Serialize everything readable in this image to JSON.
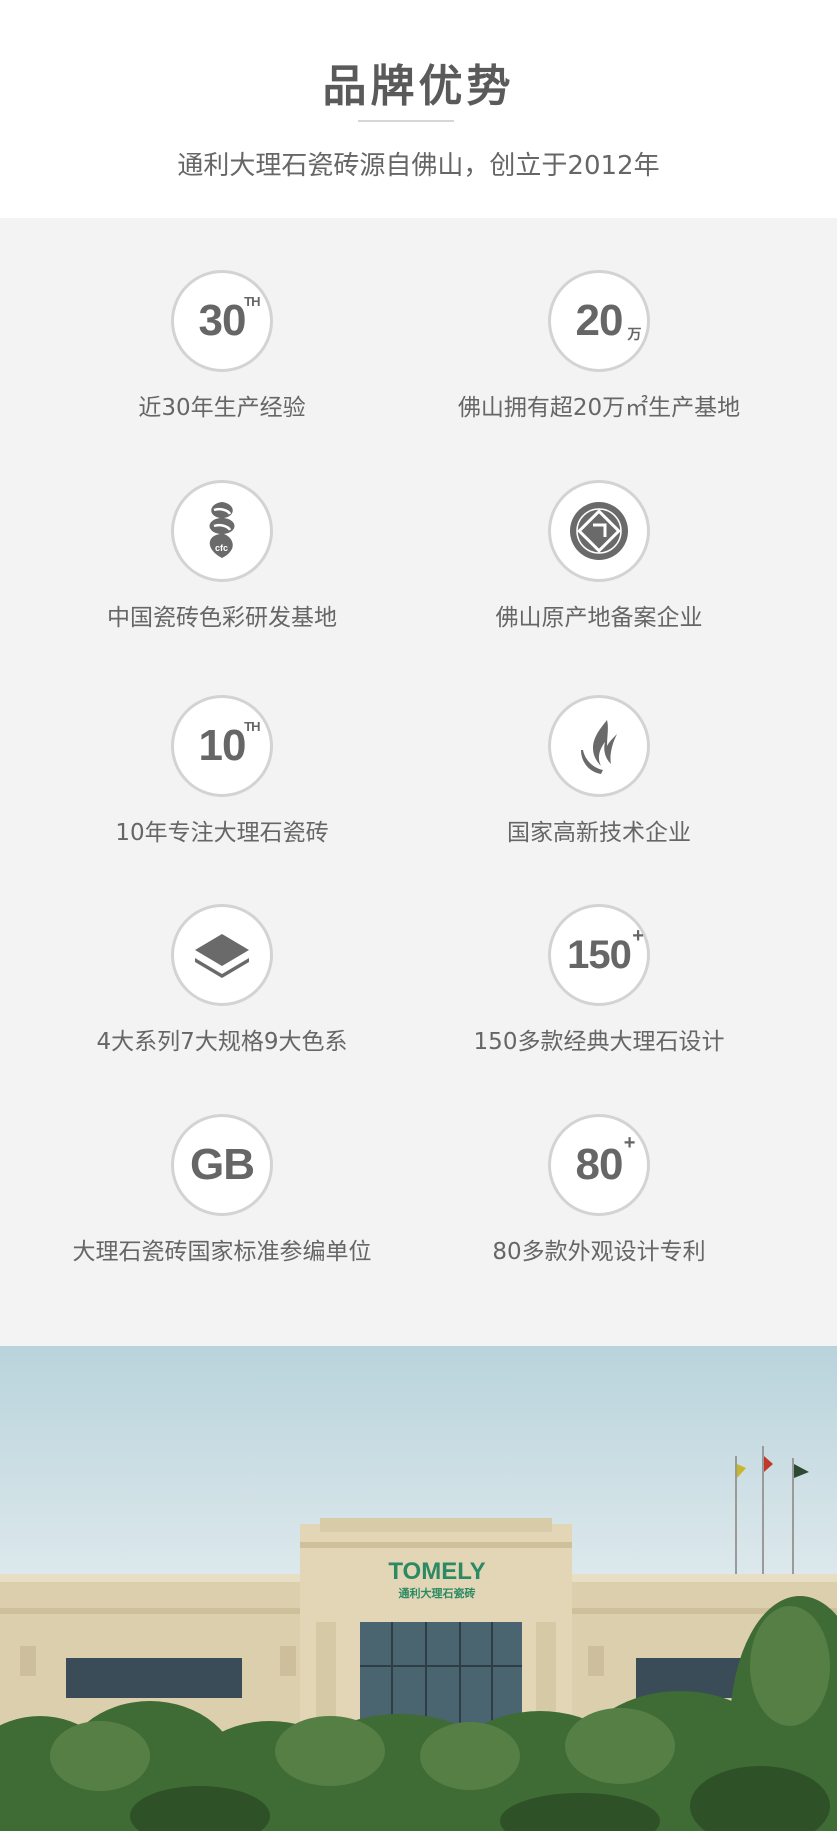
{
  "header": {
    "title": "品牌优势",
    "subtitle": "通利大理石瓷砖源自佛山，创立于2012年"
  },
  "features": [
    {
      "badge": "30",
      "badge_sup": "TH",
      "label": "近30年生产经验",
      "icon": "number-30th-icon"
    },
    {
      "badge": "20",
      "badge_sup": "万",
      "label": "佛山拥有超20万㎡生产基地",
      "icon": "number-20-wan-icon"
    },
    {
      "badge": "",
      "badge_sup": "",
      "label": "中国瓷砖色彩研发基地",
      "icon": "cfc-logo-icon"
    },
    {
      "badge": "",
      "badge_sup": "",
      "label": "佛山原产地备案企业",
      "icon": "origin-seal-icon"
    },
    {
      "badge": "10",
      "badge_sup": "TH",
      "label": "10年专注大理石瓷砖",
      "icon": "number-10th-icon"
    },
    {
      "badge": "",
      "badge_sup": "",
      "label": "国家高新技术企业",
      "icon": "high-tech-logo-icon"
    },
    {
      "badge": "",
      "badge_sup": "",
      "label": "4大系列7大规格9大色系",
      "icon": "layers-icon"
    },
    {
      "badge": "150",
      "badge_sup": "+",
      "label": "150多款经典大理石设计",
      "icon": "number-150-plus-icon"
    },
    {
      "badge": "GB",
      "badge_sup": "",
      "label": "大理石瓷砖国家标准参编单位",
      "icon": "gb-standard-icon"
    },
    {
      "badge": "80",
      "badge_sup": "+",
      "label": "80多款外观设计专利",
      "icon": "number-80-plus-icon"
    }
  ],
  "photo": {
    "brand_name": "TOMELY",
    "brand_sub": "通利大理石瓷砖"
  }
}
